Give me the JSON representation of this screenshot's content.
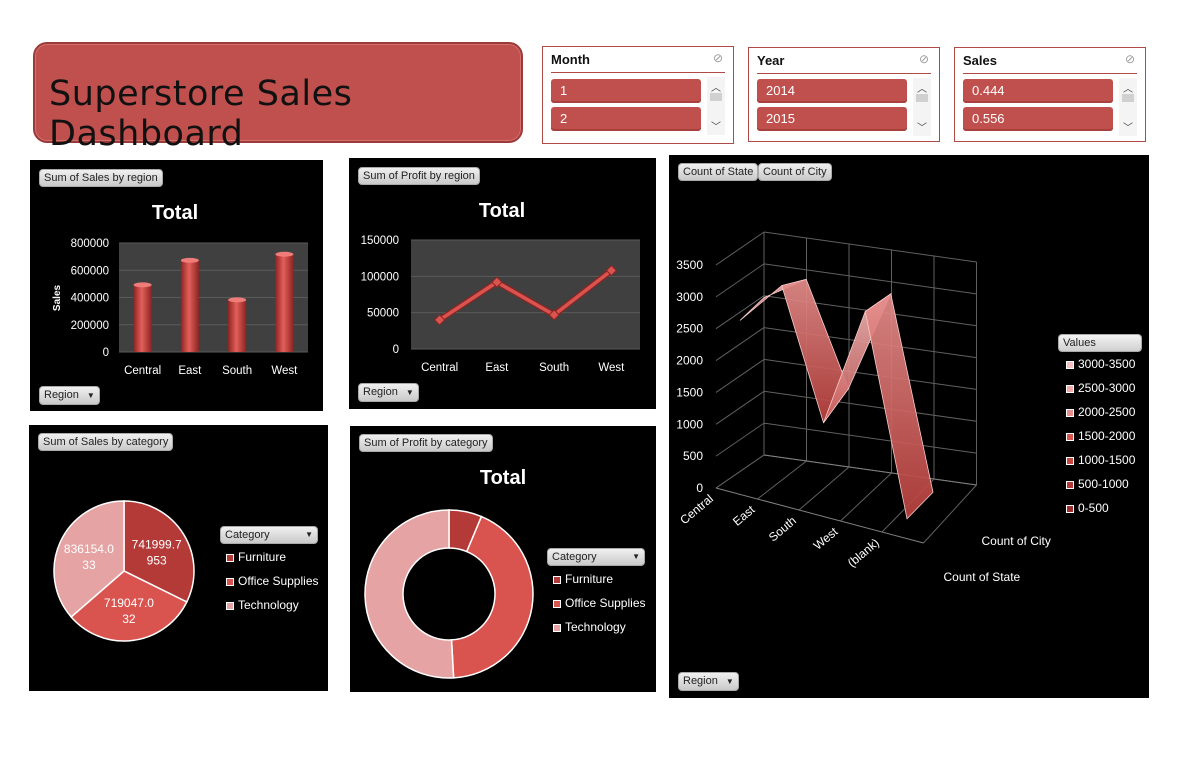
{
  "dashboard_title": "Superstore Sales Dashboard",
  "slicers": [
    {
      "header": "Month",
      "items": [
        "1",
        "2"
      ]
    },
    {
      "header": "Year",
      "items": [
        "2014",
        "2015"
      ]
    },
    {
      "header": "Sales",
      "items": [
        "0.444",
        "0.556"
      ]
    }
  ],
  "colors": {
    "accent": "#c0504d",
    "panel": "#000000",
    "plot_area": "#3f3f3f"
  },
  "chart_data": [
    {
      "type": "bar",
      "field_button": "Sum of Sales by region",
      "title": "Total",
      "ylabel": "Sales",
      "categories": [
        "Central",
        "East",
        "South",
        "West"
      ],
      "values": [
        500000,
        680000,
        390000,
        725000
      ],
      "yticks": [
        "800000",
        "600000",
        "400000",
        "200000",
        "0"
      ],
      "ylim": [
        0,
        800000
      ],
      "filter_button": "Region",
      "grid": true
    },
    {
      "type": "line",
      "field_button": "Sum of Profit by region",
      "title": "Total",
      "categories": [
        "Central",
        "East",
        "South",
        "West"
      ],
      "values": [
        40000,
        92000,
        47000,
        108000
      ],
      "yticks": [
        "150000",
        "100000",
        "50000",
        "0"
      ],
      "ylim": [
        0,
        150000
      ],
      "filter_button": "Region",
      "grid": true
    },
    {
      "type": "pie",
      "field_button": "Sum of Sales by category",
      "categories": [
        "Furniture",
        "Office Supplies",
        "Technology"
      ],
      "values": [
        741999.7953,
        719047.032,
        836154.033
      ],
      "data_labels": [
        [
          "741999.7",
          "953"
        ],
        [
          "719047.0",
          "32"
        ],
        [
          "836154.0",
          "33"
        ]
      ],
      "legend_title": "Category",
      "legend": "right",
      "colors": [
        "#b43a38",
        "#d9534f",
        "#e6a3a3"
      ]
    },
    {
      "type": "pie",
      "subtype": "doughnut",
      "field_button": "Sum of Profit by category",
      "title": "Total",
      "categories": [
        "Furniture",
        "Office Supplies",
        "Technology"
      ],
      "values": [
        18000,
        122000,
        145000
      ],
      "legend_title": "Category",
      "legend": "right",
      "colors": [
        "#b43a38",
        "#d9534f",
        "#e6a3a3"
      ]
    },
    {
      "type": "area",
      "subtype": "3d-surface",
      "field_buttons": [
        "Count of State",
        "Count of City"
      ],
      "categories": [
        "Central",
        "East",
        "South",
        "West",
        "(blank)"
      ],
      "series": [
        {
          "name": "Count of State",
          "values": [
            2500,
            3200,
            1200,
            3100,
            0
          ]
        },
        {
          "name": "Count of City",
          "values": [
            2600,
            3000,
            1400,
            3000,
            0
          ]
        }
      ],
      "yticks": [
        "3500",
        "3000",
        "2500",
        "2000",
        "1500",
        "1000",
        "500",
        "0"
      ],
      "ylim": [
        0,
        3500
      ],
      "legend_title": "Values",
      "legend": [
        "3000-3500",
        "2500-3000",
        "2000-2500",
        "1500-2000",
        "1000-1500",
        "500-1000",
        "0-500"
      ],
      "filter_button": "Region"
    }
  ]
}
